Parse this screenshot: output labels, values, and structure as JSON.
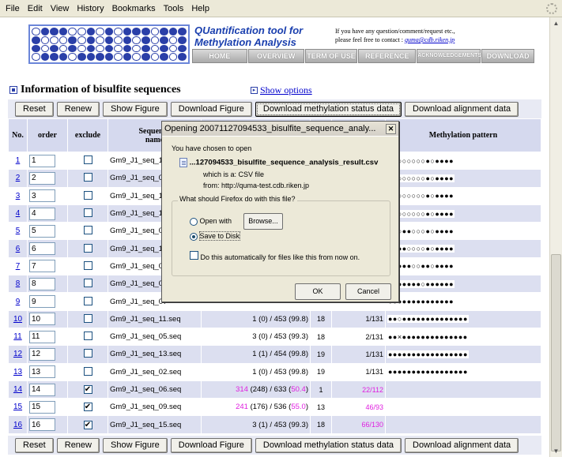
{
  "menu": [
    "File",
    "Edit",
    "View",
    "History",
    "Bookmarks",
    "Tools",
    "Help"
  ],
  "header": {
    "title_line1": "QUantification tool for",
    "title_line2": "Methylation Analysis",
    "contact_line1": "If you have any question/comment/request etc.,",
    "contact_line2": "please feel free to contact :",
    "contact_email": "quma@cdb.riken.jp",
    "nav": [
      "HOME",
      "OVERVIEW",
      "TERM OF USE",
      "REFERENCE",
      "ACKNOWLEDGEMENTS",
      "DOWNLOAD"
    ]
  },
  "section": {
    "title": "Information of bisulfite sequences",
    "show_options": "Show options"
  },
  "buttons": {
    "reset": "Reset",
    "renew": "Renew",
    "show_figure": "Show Figure",
    "download_figure": "Download Figure",
    "download_methylation": "Download methylation status data",
    "download_alignment": "Download alignment data"
  },
  "table": {
    "headers": {
      "no": "No.",
      "order": "order",
      "exclude": "exclude",
      "name_top": "Sequence",
      "name_bottom": "name",
      "pattern": "Methylation pattern"
    },
    "rows": [
      {
        "no": "1",
        "order": "1",
        "exclude": false,
        "name": "Gm9_J1_seq_10",
        "c1": "",
        "c2": "",
        "c3": "",
        "pattern": "●○○○○○○○●○●●●●"
      },
      {
        "no": "2",
        "order": "2",
        "exclude": false,
        "name": "Gm9_J1_seq_03",
        "c1": "",
        "c2": "",
        "c3": "",
        "pattern": "○○○○○○○○●○●●●●"
      },
      {
        "no": "3",
        "order": "3",
        "exclude": false,
        "name": "Gm9_J1_seq_14",
        "c1": "",
        "c2": "",
        "c3": "",
        "pattern": "○○○○○○○○●○●●●●"
      },
      {
        "no": "4",
        "order": "4",
        "exclude": false,
        "name": "Gm9_J1_seq_12",
        "c1": "",
        "c2": "",
        "c3": "",
        "pattern": "○○○○○○○○●○●●●●"
      },
      {
        "no": "5",
        "order": "5",
        "exclude": false,
        "name": "Gm9_J1_seq_04",
        "c1": "",
        "c2": "",
        "c3": "",
        "pattern": "○●○●●○○○●○●●●●"
      },
      {
        "no": "6",
        "order": "6",
        "exclude": false,
        "name": "Gm9_J1_seq_16",
        "c1": "",
        "c2": "",
        "c3": "",
        "pattern": "●○●●○○○○●○●●●●"
      },
      {
        "no": "7",
        "order": "7",
        "exclude": false,
        "name": "Gm9_J1_seq_08",
        "c1": "",
        "c2": "",
        "c3": "",
        "pattern": "●○●●●○○●●○●●●●"
      },
      {
        "no": "8",
        "order": "8",
        "exclude": false,
        "name": "Gm9_J1_seq_01",
        "c1": "",
        "c2": "",
        "c3": "",
        "pattern": "●●●●●●●○●●●●●●"
      },
      {
        "no": "9",
        "order": "9",
        "exclude": false,
        "name": "Gm9_J1_seq_07",
        "c1": "",
        "c2": "",
        "c3": "",
        "pattern": "●●●●●●●●●●●●●●"
      },
      {
        "no": "10",
        "order": "10",
        "exclude": false,
        "name": "Gm9_J1_seq_11.seq",
        "c1": "1 (0) / 453 (99.8)",
        "c2": "18",
        "c3": "1/131",
        "pattern": "●●○●●●●●●●●●●●●●●"
      },
      {
        "no": "11",
        "order": "11",
        "exclude": false,
        "name": "Gm9_J1_seq_05.seq",
        "c1": "3 (0) / 453 (99.3)",
        "c2": "18",
        "c3": "2/131",
        "pattern": "●●×●●●●●●●●●●●●●●"
      },
      {
        "no": "12",
        "order": "12",
        "exclude": false,
        "name": "Gm9_J1_seq_13.seq",
        "c1": "1 (1) / 454 (99.8)",
        "c2": "19",
        "c3": "1/131",
        "pattern": "●●●●●●●●●●●●●●●●●"
      },
      {
        "no": "13",
        "order": "13",
        "exclude": false,
        "name": "Gm9_J1_seq_02.seq",
        "c1": "1 (0) / 453 (99.8)",
        "c2": "19",
        "c3": "1/131",
        "pattern": "●●●●●●●●●●●●●●●●●"
      },
      {
        "no": "14",
        "order": "14",
        "exclude": true,
        "name": "Gm9_J1_seq_06.seq",
        "c1a": "314",
        "c1b": " (248) / 633 (",
        "c1c": "50.4",
        "c1d": ")",
        "c2": "1",
        "c3": "22/112",
        "magenta": true,
        "pattern": ""
      },
      {
        "no": "15",
        "order": "15",
        "exclude": true,
        "name": "Gm9_J1_seq_09.seq",
        "c1a": "241",
        "c1b": " (176) / 536 (",
        "c1c": "55.0",
        "c1d": ")",
        "c2": "13",
        "c3": "46/93",
        "magenta": true,
        "pattern": ""
      },
      {
        "no": "16",
        "order": "16",
        "exclude": true,
        "name": "Gm9_J1_seq_15.seq",
        "c1": "3 (1) / 453 (99.3)",
        "c2": "18",
        "c3": "66/130",
        "c3mag": true,
        "pattern": ""
      }
    ]
  },
  "dialog": {
    "title": "Opening 20071127094533_bisulfite_sequence_analy...",
    "chosen": "You have chosen to open",
    "filename": "...127094533_bisulfite_sequence_analysis_result.csv",
    "which_is": "which is a:  CSV file",
    "from": "from:  http://quma-test.cdb.riken.jp",
    "question": "What should Firefox do with this file?",
    "open_with": "Open with",
    "browse": "Browse...",
    "save_to_disk": "Save to Disk",
    "auto": "Do this automatically for files like this from now on.",
    "ok": "OK",
    "cancel": "Cancel"
  }
}
